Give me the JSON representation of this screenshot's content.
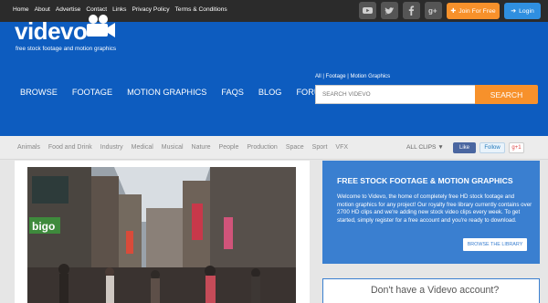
{
  "topbar": {
    "links": [
      "Home",
      "About",
      "Advertise",
      "Contact",
      "Links",
      "Privacy Policy",
      "Terms & Conditions"
    ],
    "social_icons": [
      "youtube-icon",
      "twitter-icon",
      "facebook-icon",
      "google-plus-icon"
    ],
    "join_label": "Join For Free",
    "login_label": "Login"
  },
  "header": {
    "logo": "videvo",
    "tagline": "free stock footage and motion graphics",
    "nav": [
      "BROWSE",
      "FOOTAGE",
      "MOTION GRAPHICS",
      "FAQS",
      "BLOG",
      "FORUMS"
    ],
    "filters": "All | Footage | Motion Graphics",
    "search_placeholder": "SEARCH VIDEVO",
    "search_button": "SEARCH"
  },
  "categories": {
    "items": [
      "Animals",
      "Food and Drink",
      "Industry",
      "Medical",
      "Musical",
      "Nature",
      "People",
      "Production",
      "Space",
      "Sport",
      "VFX"
    ],
    "all_clips": "ALL CLIPS ▼",
    "like_label": "Like",
    "follow_label": "Follow",
    "gplus_label": "g+1"
  },
  "sidebar": {
    "title": "FREE STOCK FOOTAGE & MOTION GRAPHICS",
    "text": "Welcome to Videvo, the home of completely free HD stock footage and motion graphics for any project! Our royalty free library currently contains over 2700 HD clips and we're adding new stock video clips every week. To get started, simply register for a free account and you're ready to download.",
    "browse_button": "BROWSE THE LIBRARY",
    "account_prompt": "Don't have a Videvo account?"
  },
  "colors": {
    "header_blue": "#0d5cbf",
    "accent_orange": "#f7912b",
    "panel_blue": "#3a7fd0",
    "topbar_dark": "#2b2b2b"
  }
}
